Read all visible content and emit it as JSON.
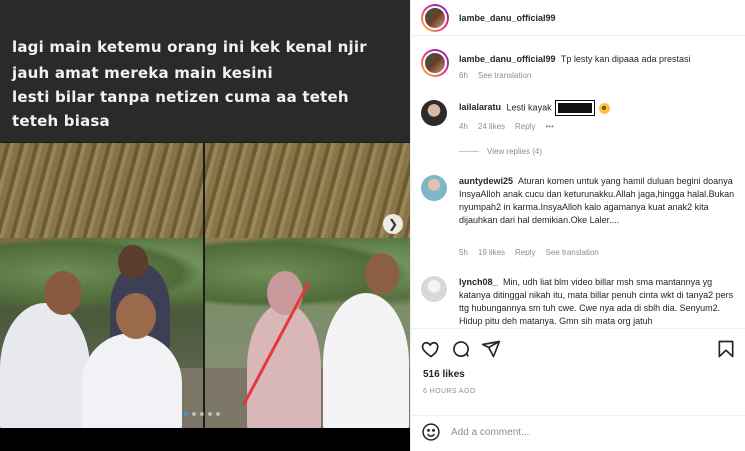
{
  "media": {
    "caption_lines": [
      "lagi main ketemu orang ini kek kenal njir",
      "jauh amat mereka main kesini",
      "lesti bilar tanpa netizen cuma aa teteh",
      "teteh biasa"
    ],
    "next_icon": "chevron-right-icon",
    "carousel_dots": 5,
    "active_dot": 0
  },
  "header": {
    "username": "lambe_danu_official99"
  },
  "comments": [
    {
      "username": "lambe_danu_official99",
      "text": "Tp lesty kan dipaaa ada prestasi",
      "time": "6h",
      "likes": "",
      "reply": "",
      "translation": "See translation"
    },
    {
      "username": "lailalaratu",
      "text": "Lesti kayak",
      "time": "4h",
      "likes": "24 likes",
      "reply": "Reply",
      "translation": "",
      "more": "•••",
      "view_replies": "View replies (4)"
    },
    {
      "username": "auntydewi25",
      "text": "Aturan komen untuk yang hamil duluan begini doanya InsyaAlloh anak cucu dan keturunakku.Allah jaga,hingga halal.Bukan nyumpah2 in karma.InsyaAlloh kalo agamanya kuat anak2 kita dijauhkan dari hal demikian.Oke Laler....",
      "time": "5h",
      "likes": "19 likes",
      "reply": "Reply",
      "translation": "See translation"
    },
    {
      "username": "lynch08_",
      "text": "Min, udh liat blm video billar msh sma mantannya yg katanya ditinggal nikah itu, mata billar penuh cinta wkt di tanya2 pers ttg hubungannya sm tuh cwe. Cwe nya ada di sblh dia. Senyum2. Hidup pitu deh matanya. Gmn sih mata org jatuh",
      "time": "",
      "likes": "",
      "reply": "",
      "translation": ""
    }
  ],
  "actions": {
    "like_icon": "heart-icon",
    "comment_icon": "comment-icon",
    "share_icon": "share-icon",
    "save_icon": "bookmark-icon",
    "likes": "516 likes",
    "time_ago": "6 HOURS AGO"
  },
  "add_comment": {
    "emoji_icon": "smiley-icon",
    "placeholder": "Add a comment..."
  }
}
